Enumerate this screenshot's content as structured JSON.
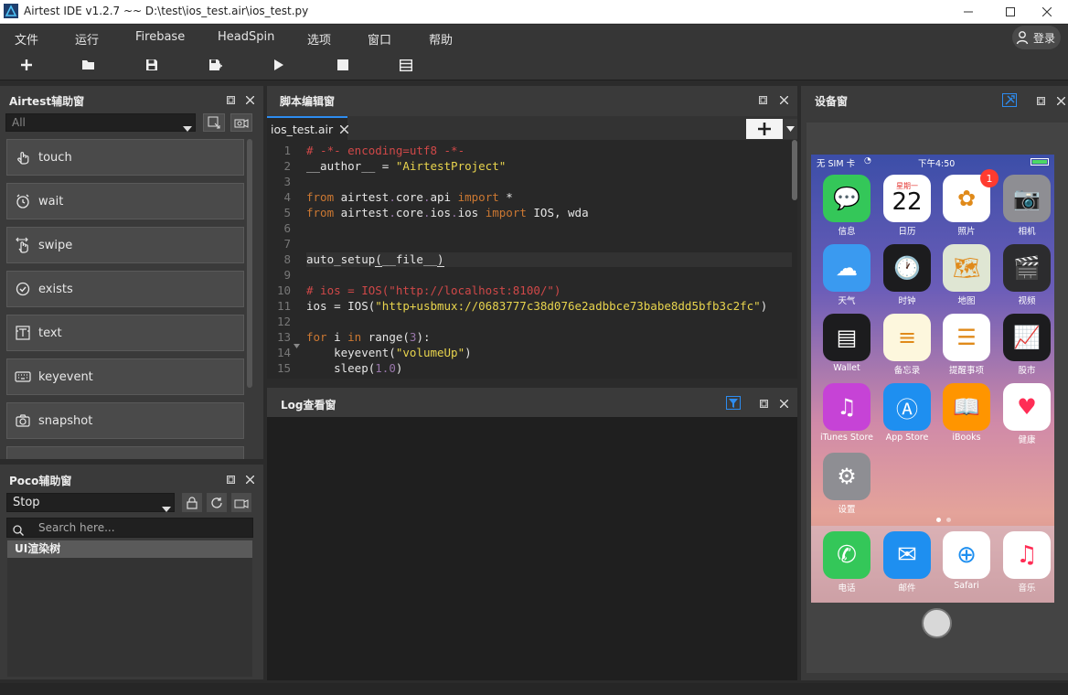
{
  "window": {
    "title": "Airtest IDE v1.2.7 ~~ D:\\test\\ios_test.air\\ios_test.py"
  },
  "menubar": {
    "items": [
      "文件",
      "运行",
      "Firebase",
      "HeadSpin",
      "选项",
      "窗口",
      "帮助"
    ],
    "login": "登录"
  },
  "airtest_panel": {
    "title": "Airtest辅助窗",
    "filter": "All",
    "items": [
      "touch",
      "wait",
      "swipe",
      "exists",
      "text",
      "keyevent",
      "snapshot"
    ]
  },
  "poco_panel": {
    "title": "Poco辅助窗",
    "mode": "Stop",
    "search_placeholder": "Search here...",
    "tree_root": "UI渲染树"
  },
  "editor": {
    "title": "脚本编辑窗",
    "tab": "ios_test.air",
    "lines": [
      {
        "n": "1",
        "text": "# -*- encoding=utf8 -*-"
      },
      {
        "n": "2",
        "text": "__author__ = \"AirtestProject\""
      },
      {
        "n": "3",
        "text": ""
      },
      {
        "n": "4",
        "text": "from airtest.core.api import *"
      },
      {
        "n": "5",
        "text": "from airtest.core.ios.ios import IOS, wda"
      },
      {
        "n": "6",
        "text": ""
      },
      {
        "n": "7",
        "text": ""
      },
      {
        "n": "8",
        "text": "auto_setup(__file__)"
      },
      {
        "n": "9",
        "text": ""
      },
      {
        "n": "10",
        "text": "# ios = IOS(\"http://localhost:8100/\")"
      },
      {
        "n": "11",
        "text": "ios = IOS(\"http+usbmux://0683777c38d076e2adbbce73babe8dd5bfb3c2fc\")"
      },
      {
        "n": "12",
        "text": ""
      },
      {
        "n": "13",
        "text": "for i in range(3):"
      },
      {
        "n": "14",
        "text": "    keyevent(\"volumeUp\")"
      },
      {
        "n": "15",
        "text": "    sleep(1.0)"
      }
    ]
  },
  "log_panel": {
    "title": "Log查看窗"
  },
  "device_panel": {
    "title": "设备窗",
    "status": {
      "carrier": "无 SIM 卡",
      "time": "下午4:50"
    },
    "calendar": {
      "weekday": "星期一",
      "day": "22"
    },
    "photos_badge": "1",
    "apps": [
      {
        "label": "信息",
        "color": "#34c759",
        "glyph": "💬"
      },
      {
        "label": "日历",
        "color": "#ffffff",
        "glyph": ""
      },
      {
        "label": "照片",
        "color": "#ffffff",
        "glyph": "✿"
      },
      {
        "label": "相机",
        "color": "#8e8e93",
        "glyph": "📷"
      },
      {
        "label": "天气",
        "color": "#3a9af0",
        "glyph": "☁"
      },
      {
        "label": "时钟",
        "color": "#1c1c1e",
        "glyph": "🕐"
      },
      {
        "label": "地图",
        "color": "#dfe6d3",
        "glyph": "🗺"
      },
      {
        "label": "视频",
        "color": "#2c2c2e",
        "glyph": "🎬"
      },
      {
        "label": "Wallet",
        "color": "#1c1c1e",
        "glyph": "▤"
      },
      {
        "label": "备忘录",
        "color": "#fdf7dd",
        "glyph": "≡"
      },
      {
        "label": "提醒事项",
        "color": "#ffffff",
        "glyph": "☰"
      },
      {
        "label": "股市",
        "color": "#1c1c1e",
        "glyph": "📈"
      },
      {
        "label": "iTunes Store",
        "color": "#c643d6",
        "glyph": "♫"
      },
      {
        "label": "App Store",
        "color": "#1e8ff0",
        "glyph": "Ⓐ"
      },
      {
        "label": "iBooks",
        "color": "#ff9500",
        "glyph": "📖"
      },
      {
        "label": "健康",
        "color": "#ffffff",
        "glyph": "♥"
      },
      {
        "label": "设置",
        "color": "#8e8e93",
        "glyph": "⚙"
      }
    ],
    "dock": [
      {
        "label": "电话",
        "color": "#34c759",
        "glyph": "✆"
      },
      {
        "label": "邮件",
        "color": "#1e8ff0",
        "glyph": "✉"
      },
      {
        "label": "Safari",
        "color": "#ffffff",
        "glyph": "⊕"
      },
      {
        "label": "音乐",
        "color": "#ffffff",
        "glyph": "♫"
      }
    ]
  },
  "colors": {
    "accent": "#2d8cf0",
    "panel": "#3a3a3a",
    "editor_bg": "#282828",
    "keyword": "#cc7832",
    "string": "#e8d44d",
    "comment": "#d04848"
  }
}
